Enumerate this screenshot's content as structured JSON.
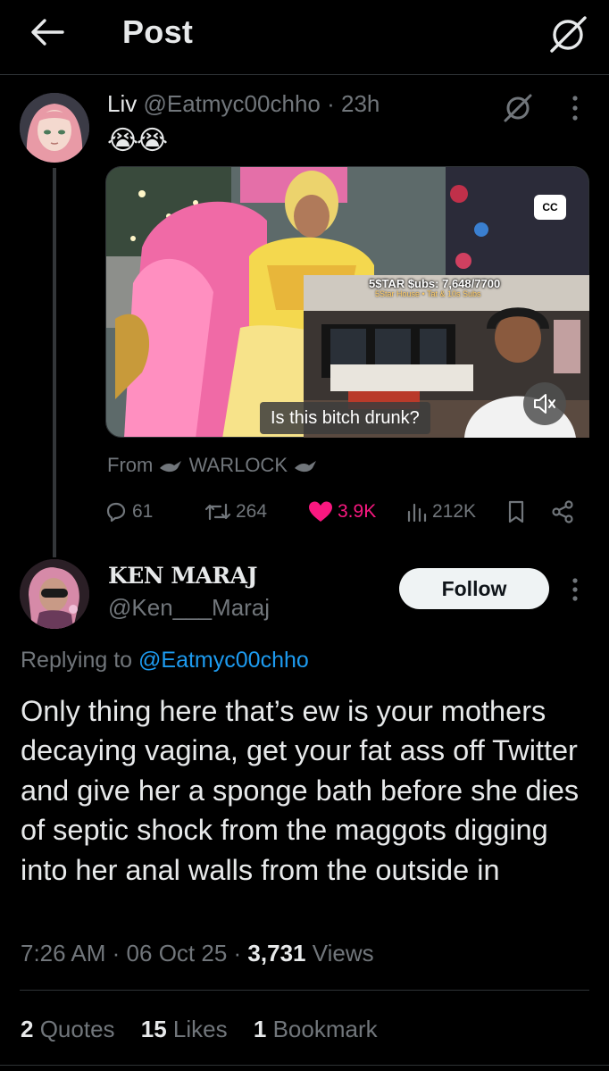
{
  "header": {
    "title": "Post"
  },
  "parent_post": {
    "name": "Liv",
    "handle": "@Eatmyc00chho",
    "dot": "·",
    "time": "23h",
    "emoji": "😭😭",
    "media": {
      "cc_label": "CC",
      "overlay_title": "5$TAR $ubs: 7,648/7700",
      "overlay_subtitle": "5Star House • Tat & 10s Subs",
      "caption": "Is this bitch drunk?"
    },
    "from_prefix": "From",
    "from_source": "WARLOCK",
    "stats": {
      "replies": "61",
      "reposts": "264",
      "likes": "3.9K",
      "views": "212K"
    }
  },
  "reply": {
    "name": "KEN MARAJ",
    "handle": "@Ken___Maraj",
    "follow_label": "Follow",
    "replying_prefix": "Replying to",
    "replying_handle": "@Eatmyc00chho",
    "text": "Only thing here that’s ew is your mothers decaying vagina, get your fat ass off Twitter and give her a sponge bath before she dies of septic shock from the maggots digging into her anal walls from the outside in",
    "time": "7:26 AM",
    "date": "06 Oct 25",
    "dot": "·",
    "views_count": "3,731",
    "views_label": "Views",
    "quotes_count": "2",
    "quotes_label": "Quotes",
    "likes_count": "15",
    "likes_label": "Likes",
    "bookmarks_count": "1",
    "bookmarks_label": "Bookmark"
  },
  "colors": {
    "background": "#000000",
    "text": "#e7e9ea",
    "muted": "#71767b",
    "link": "#1d9bf0",
    "like": "#f91880",
    "divider": "#2f3336"
  }
}
